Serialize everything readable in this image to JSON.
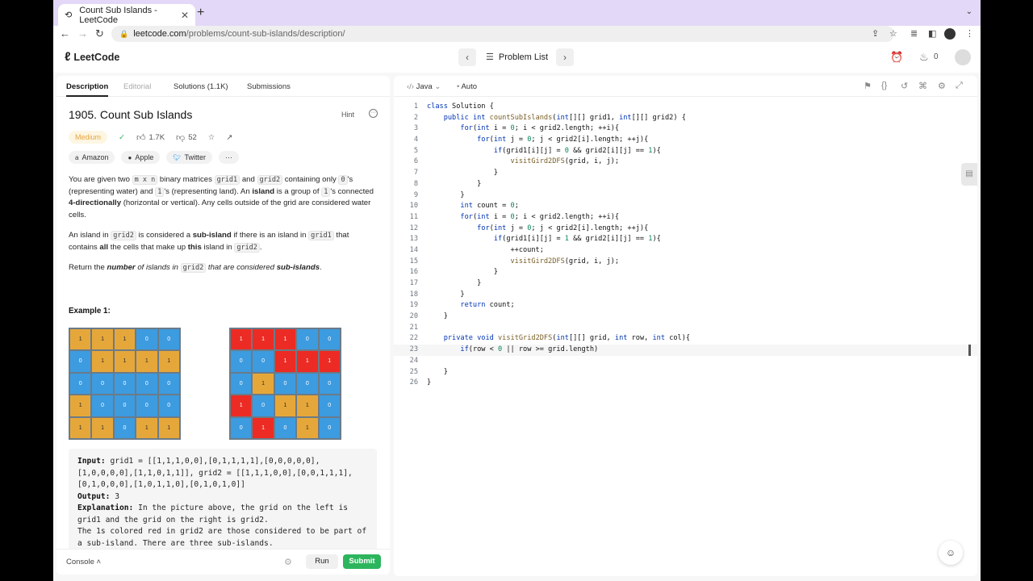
{
  "browser": {
    "tab_title": "Count Sub Islands - LeetCode",
    "url_domain": "leetcode.com",
    "url_path": "/problems/count-sub-islands/description/"
  },
  "header": {
    "logo_text": "LeetCode",
    "problem_list": "Problem List",
    "fire_count": "0"
  },
  "tabs": [
    "Description",
    "Editorial",
    "Solutions (1.1K)",
    "Submissions"
  ],
  "problem": {
    "title": "1905. Count Sub Islands",
    "hint": "Hint",
    "difficulty": "Medium",
    "likes": "1.7K",
    "dislikes": "52",
    "companies": [
      "Amazon",
      "Apple",
      "Twitter"
    ],
    "example_title": "Example 1:"
  },
  "desc": {
    "p1": [
      {
        "t": "You are given two "
      },
      {
        "c": "m x n"
      },
      {
        "t": " binary matrices "
      },
      {
        "c": "grid1"
      },
      {
        "t": " and "
      },
      {
        "c": "grid2"
      },
      {
        "t": " containing only "
      },
      {
        "c": "0"
      },
      {
        "t": "'s (representing water) and "
      },
      {
        "c": "1"
      },
      {
        "t": "'s (representing land). An "
      },
      {
        "b": "island"
      },
      {
        "t": " is a group of "
      },
      {
        "c": "1"
      },
      {
        "t": "'s connected "
      },
      {
        "b": "4-directionally"
      },
      {
        "t": " (horizontal or vertical). Any cells outside of the grid are considered water cells."
      }
    ],
    "p2": [
      {
        "t": "An island in "
      },
      {
        "c": "grid2"
      },
      {
        "t": " is considered a "
      },
      {
        "b": "sub-island"
      },
      {
        "t": " if there is an island in "
      },
      {
        "c": "grid1"
      },
      {
        "t": " that contains "
      },
      {
        "b": "all"
      },
      {
        "t": " the cells that make up "
      },
      {
        "b": "this"
      },
      {
        "t": " island in "
      },
      {
        "c": "grid2"
      },
      {
        "t": "."
      }
    ],
    "p3": [
      {
        "t": "Return the "
      },
      {
        "bi": "number"
      },
      {
        "i": " of islands in "
      },
      {
        "c": "grid2"
      },
      {
        "i": " that are considered "
      },
      {
        "bi": "sub-islands"
      },
      {
        "t": "."
      }
    ]
  },
  "grid_left": [
    [
      1,
      1,
      1,
      0,
      0
    ],
    [
      0,
      1,
      1,
      1,
      1
    ],
    [
      0,
      0,
      0,
      0,
      0
    ],
    [
      1,
      0,
      0,
      0,
      0
    ],
    [
      1,
      1,
      0,
      1,
      1
    ]
  ],
  "grid_right": [
    [
      1,
      1,
      1,
      0,
      0
    ],
    [
      0,
      0,
      1,
      1,
      1
    ],
    [
      0,
      1,
      0,
      0,
      0
    ],
    [
      1,
      0,
      1,
      1,
      0
    ],
    [
      0,
      1,
      0,
      1,
      0
    ]
  ],
  "grid_right_colors": [
    [
      2,
      2,
      2,
      0,
      0
    ],
    [
      0,
      0,
      2,
      2,
      2
    ],
    [
      0,
      1,
      0,
      0,
      0
    ],
    [
      2,
      0,
      1,
      1,
      0
    ],
    [
      0,
      2,
      0,
      1,
      0
    ]
  ],
  "colors": {
    "water": "#3d9be0",
    "land": "#e6a73a",
    "sub": "#ec2b24",
    "accent": "#2db55d"
  },
  "example": {
    "input_label": "Input:",
    "input_value": "grid1 = [[1,1,1,0,0],[0,1,1,1,1],[0,0,0,0,0],[1,0,0,0,0],[1,1,0,1,1]], grid2 = [[1,1,1,0,0],[0,0,1,1,1],[0,1,0,0,0],[1,0,1,1,0],[0,1,0,1,0]]",
    "output_label": "Output:",
    "output_value": "3",
    "explanation_label": "Explanation:",
    "explanation_value": "In the picture above, the grid on the left is grid1 and the grid on the right is grid2.",
    "explanation_more": "The 1s colored red in grid2 are those considered to be part of a sub-island. There are three sub-islands."
  },
  "footer": {
    "console": "Console",
    "run": "Run",
    "submit": "Submit"
  },
  "editor": {
    "language": "Java",
    "mode": "Auto",
    "lines": [
      "class Solution {",
      "    public int countSubIslands(int[][] grid1, int[][] grid2) {",
      "        for(int i = 0; i < grid2.length; ++i){",
      "            for(int j = 0; j < grid2[i].length; ++j){",
      "                if(grid1[i][j] = 0 && grid2[i][j] == 1){",
      "                    visitGird2DFS(grid, i, j);",
      "                }",
      "            }",
      "        }",
      "        int count = 0;",
      "        for(int i = 0; i < grid2.length; ++i){",
      "            for(int j = 0; j < grid2[i].length; ++j){",
      "                if(grid1[i][j] = 1 && grid2[i][j] == 1){",
      "                    ++count;",
      "                    visitGird2DFS(grid, i, j);",
      "                }",
      "            }",
      "        }",
      "        return count;",
      "    }",
      "",
      "    private void visitGrid2DFS(int[][] grid, int row, int col){",
      "        if(row < 0 || row >= grid.length)",
      "",
      "    }",
      "}"
    ],
    "current_line": 23
  }
}
